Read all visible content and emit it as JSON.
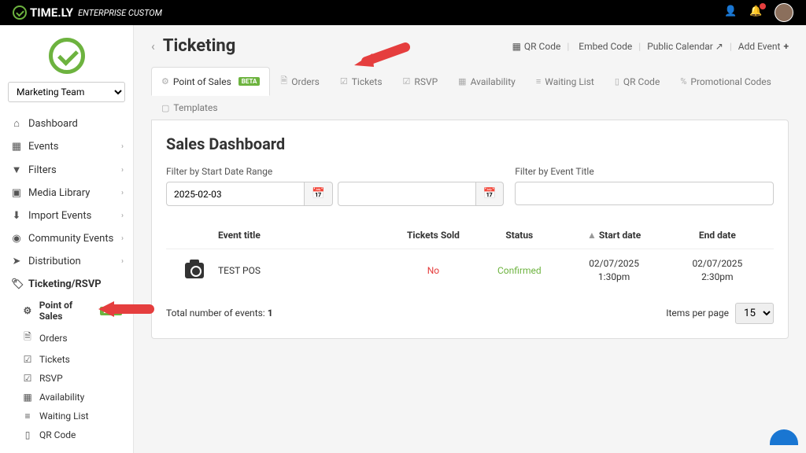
{
  "brand": {
    "name": "TIME.LY",
    "sub": "ENTERPRISE CUSTOM"
  },
  "team_select": "Marketing Team",
  "nav": [
    {
      "icon": "⌂",
      "label": "Dashboard",
      "chev": false
    },
    {
      "icon": "▦",
      "label": "Events",
      "chev": true
    },
    {
      "icon": "▼",
      "label": "Filters",
      "chev": true
    },
    {
      "icon": "▣",
      "label": "Media Library",
      "chev": true
    },
    {
      "icon": "⬇",
      "label": "Import Events",
      "chev": true
    },
    {
      "icon": "◉",
      "label": "Community Events",
      "chev": true
    },
    {
      "icon": "➤",
      "label": "Distribution",
      "chev": true
    },
    {
      "icon": "🏷",
      "label": "Ticketing/RSVP",
      "chev": false,
      "active": true
    }
  ],
  "subnav": [
    {
      "icon": "⚙",
      "label": "Point of Sales",
      "active": true,
      "beta": "BETA"
    },
    {
      "icon": "🗎",
      "label": "Orders"
    },
    {
      "icon": "☑",
      "label": "Tickets"
    },
    {
      "icon": "☑",
      "label": "RSVP"
    },
    {
      "icon": "▦",
      "label": "Availability"
    },
    {
      "icon": "≡",
      "label": "Waiting List"
    },
    {
      "icon": "▯",
      "label": "QR Code"
    }
  ],
  "page": {
    "title": "Ticketing"
  },
  "header_actions": [
    {
      "icon": "▦",
      "label": "QR Code"
    },
    {
      "icon": "</>",
      "label": "Embed Code"
    },
    {
      "icon": "",
      "label": "Public Calendar",
      "ext": true
    },
    {
      "icon": "",
      "label": "Add Event",
      "plus": true
    }
  ],
  "tabs": [
    {
      "icon": "⚙",
      "label": "Point of Sales",
      "active": true,
      "beta": "BETA"
    },
    {
      "icon": "🗎",
      "label": "Orders"
    },
    {
      "icon": "☑",
      "label": "Tickets"
    },
    {
      "icon": "☑",
      "label": "RSVP"
    },
    {
      "icon": "▦",
      "label": "Availability"
    },
    {
      "icon": "≡",
      "label": "Waiting List"
    },
    {
      "icon": "▯",
      "label": "QR Code"
    },
    {
      "icon": "%",
      "label": "Promotional Codes"
    },
    {
      "icon": "▢",
      "label": "Templates"
    }
  ],
  "panel": {
    "title": "Sales Dashboard",
    "filter_date_label": "Filter by Start Date Range",
    "filter_title_label": "Filter by Event Title",
    "start_date": "2025-02-03"
  },
  "columns": {
    "event": "Event title",
    "sold": "Tickets Sold",
    "status": "Status",
    "start": "Start date",
    "end": "End date"
  },
  "row": {
    "title": "TEST POS",
    "sold": "No",
    "status": "Confirmed",
    "start_date": "02/07/2025",
    "start_time": "1:30pm",
    "end_date": "02/07/2025",
    "end_time": "2:30pm"
  },
  "footer": {
    "total_label": "Total number of events:",
    "total": "1",
    "per_page_label": "Items per page",
    "per_page": "15"
  }
}
